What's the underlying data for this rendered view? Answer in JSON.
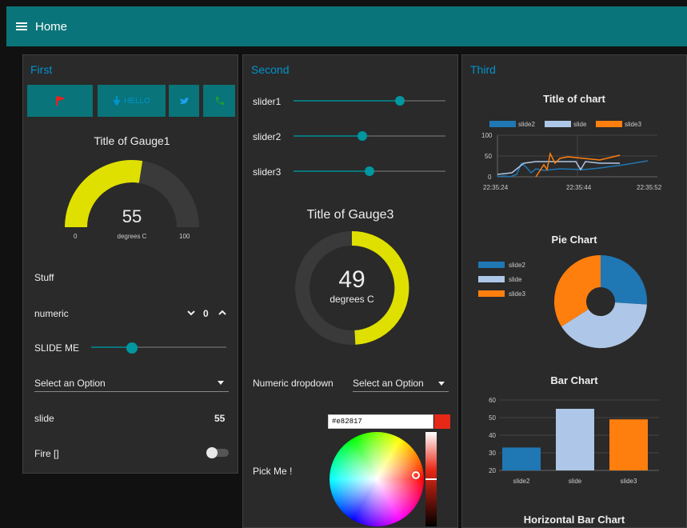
{
  "header": {
    "title": "Home"
  },
  "groups": {
    "first": "First",
    "second": "Second",
    "third": "Third"
  },
  "buttons": {
    "hello": "HELLO"
  },
  "gauge1": {
    "title": "Title of Gauge1",
    "value": "55",
    "units": "degrees C",
    "min": "0",
    "max": "100"
  },
  "first": {
    "stuff": "Stuff",
    "numeric_label": "numeric",
    "numeric_value": "0",
    "slide_me": "SLIDE ME",
    "dropdown": "Select an Option",
    "slide_label": "slide",
    "slide_value": "55",
    "fire_label": "Fire []"
  },
  "second": {
    "slider1": "slider1",
    "slider2": "slider2",
    "slider3": "slider3",
    "numeric_dropdown_label": "Numeric dropdown",
    "numeric_dropdown_value": "Select an Option",
    "pick_me": "Pick Me !",
    "color_hex": "#e82817"
  },
  "gauge3": {
    "title": "Title of Gauge3",
    "value": "49",
    "units": "degrees C"
  },
  "line_chart": {
    "title": "Title of chart",
    "legend": [
      "slide2",
      "slide",
      "slide3"
    ],
    "y_ticks": [
      "100",
      "50",
      "0"
    ],
    "x_ticks": [
      "22:35:24",
      "22:35:44",
      "22:35:52"
    ]
  },
  "pie_chart": {
    "title": "Pie Chart",
    "legend": [
      "slide2",
      "slide",
      "slide3"
    ]
  },
  "bar_chart": {
    "title": "Bar Chart",
    "y_ticks": [
      "60",
      "50",
      "40",
      "30",
      "20"
    ],
    "categories": [
      "slide2",
      "slide",
      "slide3"
    ]
  },
  "hbar_chart": {
    "title": "Horizontal Bar Chart"
  },
  "colors": {
    "header": "#097479",
    "accent": "#0094ce",
    "gauge": "#e0e000",
    "slide2": "#1f77b4",
    "slide": "#aec7e8",
    "slide3": "#ff7f0e"
  },
  "sliders": {
    "slider1": 0.7,
    "slider2": 0.45,
    "slider3": 0.5,
    "slide_me": 0.3
  },
  "pie_values": {
    "slide2": 26,
    "slide": 40,
    "slide3": 34
  },
  "bar_values": {
    "slide2": 33,
    "slide": 55,
    "slide3": 49
  }
}
